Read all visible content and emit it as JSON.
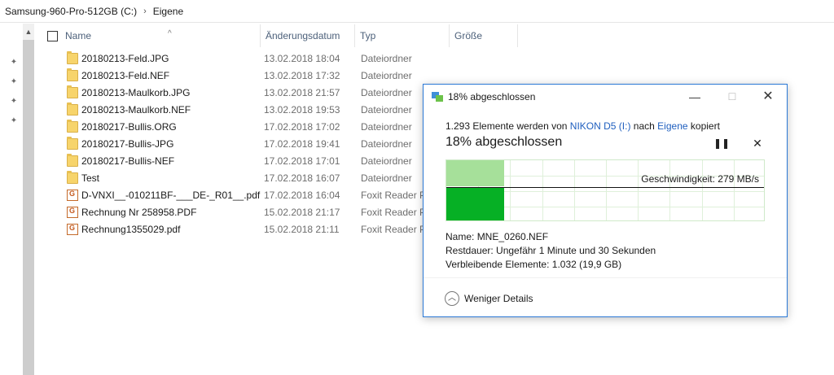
{
  "breadcrumb": [
    "Samsung-960-Pro-512GB (C:)",
    "Eigene"
  ],
  "columns": {
    "name": "Name",
    "date": "Änderungsdatum",
    "type": "Typ",
    "size": "Größe"
  },
  "files": [
    {
      "name": "20180213-Feld.JPG",
      "date": "13.02.2018 18:04",
      "type": "Dateiordner",
      "icon": "folder"
    },
    {
      "name": "20180213-Feld.NEF",
      "date": "13.02.2018 17:32",
      "type": "Dateiordner",
      "icon": "folder"
    },
    {
      "name": "20180213-Maulkorb.JPG",
      "date": "13.02.2018 21:57",
      "type": "Dateiordner",
      "icon": "folder"
    },
    {
      "name": "20180213-Maulkorb.NEF",
      "date": "13.02.2018 19:53",
      "type": "Dateiordner",
      "icon": "folder"
    },
    {
      "name": "20180217-Bullis.ORG",
      "date": "17.02.2018 17:02",
      "type": "Dateiordner",
      "icon": "folder"
    },
    {
      "name": "20180217-Bullis-JPG",
      "date": "17.02.2018 19:41",
      "type": "Dateiordner",
      "icon": "folder"
    },
    {
      "name": "20180217-Bullis-NEF",
      "date": "17.02.2018 17:01",
      "type": "Dateiordner",
      "icon": "folder"
    },
    {
      "name": "Test",
      "date": "17.02.2018 16:07",
      "type": "Dateiordner",
      "icon": "folder"
    },
    {
      "name": "D-VNXI__-010211BF-___DE-_R01__.pdf",
      "date": "17.02.2018 16:04",
      "type": "Foxit Reader PD",
      "icon": "pdf"
    },
    {
      "name": "Rechnung Nr 258958.PDF",
      "date": "15.02.2018 21:17",
      "type": "Foxit Reader PD",
      "icon": "pdf"
    },
    {
      "name": "Rechnung1355029.pdf",
      "date": "15.02.2018 21:11",
      "type": "Foxit Reader PD",
      "icon": "pdf"
    }
  ],
  "dialog": {
    "title": "18% abgeschlossen",
    "info_prefix": "1.293 Elemente werden von",
    "source": "NIKON D5 (I:)",
    "info_middle": "nach",
    "target": "Eigene",
    "info_suffix": "kopiert",
    "percent_text": "18% abgeschlossen",
    "progress_fraction": 0.18,
    "speed": "Geschwindigkeit: 279 MB/s",
    "name_label": "Name:",
    "name_value": "MNE_0260.NEF",
    "remaining_label": "Restdauer:",
    "remaining_value": "Ungefähr 1 Minute und 30 Sekunden",
    "items_label": "Verbleibende Elemente:",
    "items_value": "1.032 (19,9 GB)",
    "less_details": "Weniger Details",
    "pause_glyph": "❚❚",
    "cancel_glyph": "✕",
    "min_glyph": "—",
    "max_glyph": "☐",
    "close_glyph": "✕"
  },
  "colors": {
    "accent": "#2b79d6",
    "progress": "#06b025",
    "progress_light": "#a6e09a"
  }
}
